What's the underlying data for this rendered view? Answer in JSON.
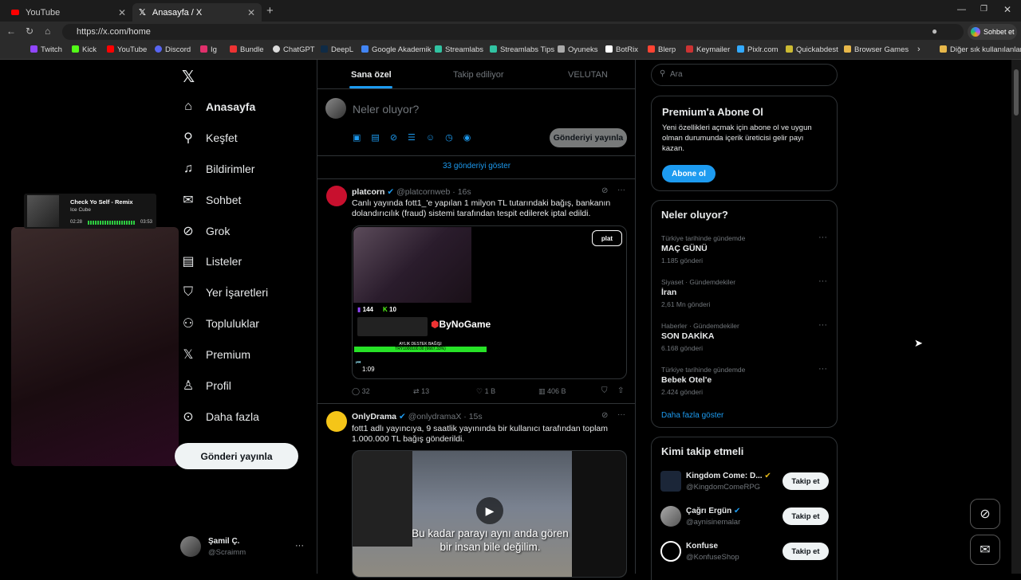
{
  "browser": {
    "tabs": [
      {
        "label": "YouTube"
      },
      {
        "label": "Anasayfa / X"
      }
    ],
    "url": "https://x.com/home",
    "profile_button": "Sohbet et",
    "bookmarks": [
      "Twitch",
      "Kick",
      "YouTube",
      "Discord",
      "Ig",
      "Bundle",
      "ChatGPT",
      "DeepL",
      "Google Akademik",
      "Streamlabs",
      "Streamlabs Tips",
      "Oyuneks",
      "BotRix",
      "Blerp",
      "Keymailer",
      "Pixlr.com",
      "Quickabdest",
      "Browser Games"
    ],
    "other_bookmarks": "Diğer sık kullanılanlar"
  },
  "music": {
    "title": "Check Yo Self - Remix",
    "artist": "Ice Cube",
    "elapsed": "02:28",
    "duration": "03:53"
  },
  "sidebar": {
    "items": [
      {
        "label": "Anasayfa"
      },
      {
        "label": "Keşfet"
      },
      {
        "label": "Bildirimler"
      },
      {
        "label": "Sohbet"
      },
      {
        "label": "Grok"
      },
      {
        "label": "Listeler"
      },
      {
        "label": "Yer İşaretleri"
      },
      {
        "label": "Topluluklar"
      },
      {
        "label": "Premium"
      },
      {
        "label": "Profil"
      },
      {
        "label": "Daha fazla"
      }
    ],
    "post_button": "Gönderi yayınla",
    "user": {
      "name": "Şamil Ç.",
      "handle": "@Scraimm"
    }
  },
  "main": {
    "tabs": [
      {
        "label": "Sana özel"
      },
      {
        "label": "Takip ediliyor"
      },
      {
        "label": "VELUTAN"
      }
    ],
    "composer": {
      "placeholder": "Neler oluyor?",
      "post_label": "Gönderiyi yayınla"
    },
    "show_more": "33 gönderiyi göster",
    "tweets": [
      {
        "name": "platcorn",
        "handle": "@platcornweb",
        "time": "16s",
        "text": "Canlı yayında fott1_'e yapılan 1 milyon TL tutarındaki bağış, bankanın dolandırıcılık (fraud) sistemi tarafından tespit edilerek iptal edildi.",
        "media": {
          "brand": "ByNoGame",
          "count1": "144",
          "count2": "10",
          "goal_label": "AYLIK DESTEK BAĞIŞI",
          "goal_bar": "TRY1000100.00 (6667.33%)",
          "duration": "1:09"
        },
        "replies": "32",
        "retweets": "13",
        "likes": "1 B",
        "views": "406 B"
      },
      {
        "name": "OnlyDrama",
        "handle": "@onlydramaX",
        "time": "15s",
        "text": "fott1 adlı yayıncıya, 9 saatlik yayınında bir kullanıcı tarafından toplam 1.000.000 TL bağış gönderildi.",
        "subtitle_line1": "Bu kadar parayı aynı anda gören",
        "subtitle_line2": "bir insan bile değilim."
      }
    ]
  },
  "right": {
    "search_placeholder": "Ara",
    "premium": {
      "title": "Premium'a Abone Ol",
      "body": "Yeni özellikleri açmak için abone ol ve uygun olman durumunda içerik üreticisi gelir payı kazan.",
      "button": "Abone ol"
    },
    "trends_title": "Neler oluyor?",
    "trends": [
      {
        "meta": "Türkiye tarihinde gündemde",
        "name": "MAÇ GÜNÜ",
        "count": "1.185 gönderi"
      },
      {
        "meta": "Siyaset · Gündemdekiler",
        "name": "İran",
        "count": "2,61 Mn gönderi"
      },
      {
        "meta": "Haberler · Gündemdekiler",
        "name": "SON DAKİKA",
        "count": "6.168 gönderi"
      },
      {
        "meta": "Türkiye tarihinde gündemde",
        "name": "Bebek Otel'e",
        "count": "2.424 gönderi"
      }
    ],
    "trends_more": "Daha fazla göster",
    "who_title": "Kimi takip etmeli",
    "who": [
      {
        "name": "Kingdom Come: D...",
        "handle": "@KingdomComeRPG",
        "button": "Takip et"
      },
      {
        "name": "Çağrı Ergün",
        "handle": "@aynisinemalar",
        "button": "Takip et"
      },
      {
        "name": "Konfuse",
        "handle": "@KonfuseShop",
        "button": "Takip et"
      }
    ]
  },
  "colors": {
    "accent": "#1d9bf0",
    "green": "#00e676",
    "bg": "#000000"
  }
}
